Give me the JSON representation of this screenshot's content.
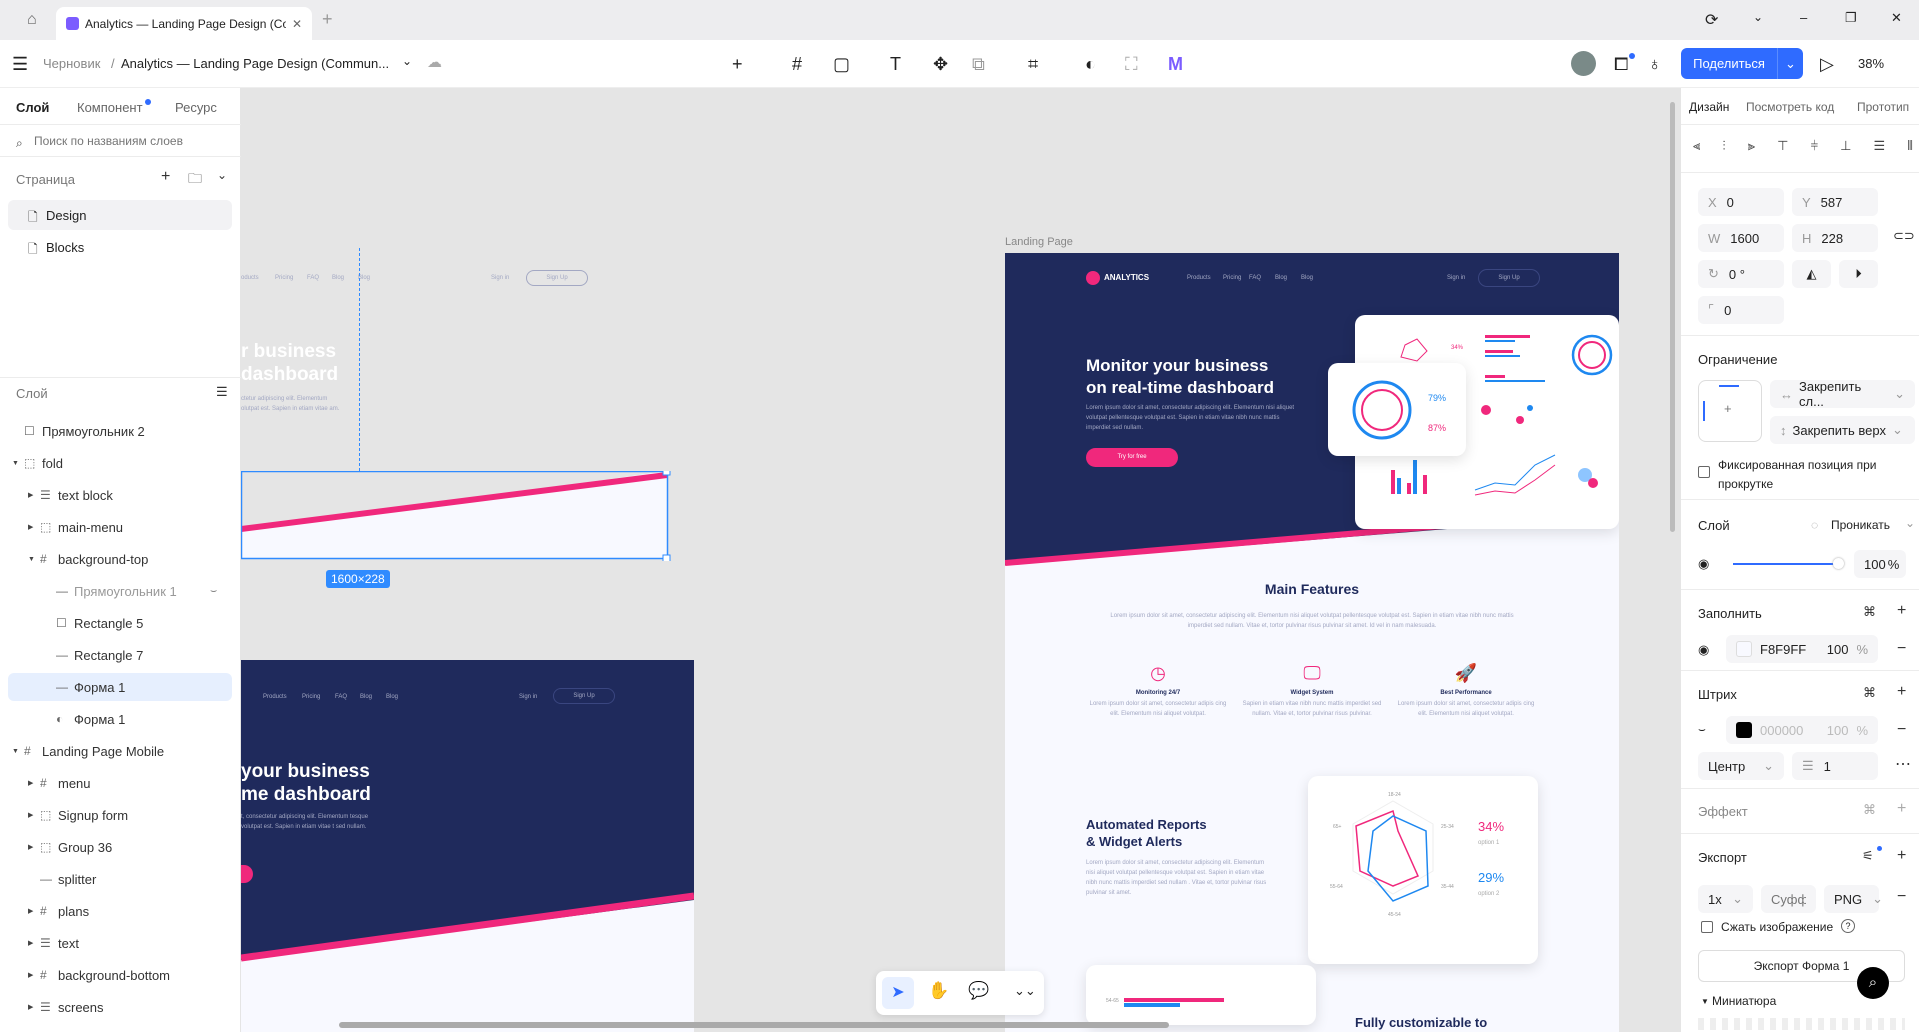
{
  "browser": {
    "tab_title": "Analytics — Landing Page Design (Cor",
    "new_tab": "+",
    "home_icon": "home-icon",
    "close_icon": "close-icon"
  },
  "toolbar": {
    "breadcrumb_root": "Черновик",
    "breadcrumb_sep": "/",
    "file_name": "Analytics — Landing Page Design (Commun...",
    "share_label": "Поделиться",
    "zoom": "38%"
  },
  "left_panel": {
    "tabs": [
      {
        "label": "Слой",
        "active": true
      },
      {
        "label": "Компонент",
        "badge": true
      },
      {
        "label": "Ресурс"
      }
    ],
    "search_placeholder": "Поиск по названиям слоев",
    "pages_header": "Страница",
    "pages": [
      {
        "label": "Design",
        "active": true
      },
      {
        "label": "Blocks"
      }
    ],
    "layers_header": "Слой",
    "layers": [
      {
        "label": "Прямоугольник 2",
        "indent": 0,
        "icon": "rect"
      },
      {
        "label": "fold",
        "indent": 0,
        "icon": "group",
        "expanded": true
      },
      {
        "label": "text block",
        "indent": 1,
        "icon": "stack",
        "collapsed": true
      },
      {
        "label": "main-menu",
        "indent": 1,
        "icon": "group",
        "collapsed": true
      },
      {
        "label": "background-top",
        "indent": 1,
        "icon": "frame",
        "expanded": true
      },
      {
        "label": "Прямоугольник 1",
        "indent": 2,
        "icon": "line",
        "hidden": true
      },
      {
        "label": "Rectangle 5",
        "indent": 2,
        "icon": "rect"
      },
      {
        "label": "Rectangle 7",
        "indent": 2,
        "icon": "line"
      },
      {
        "label": "Форма 1",
        "indent": 2,
        "icon": "line",
        "selected": true
      },
      {
        "label": "Форма 1",
        "indent": 2,
        "icon": "mask"
      },
      {
        "label": "Landing Page Mobile",
        "indent": 0,
        "icon": "frame",
        "expanded": true
      },
      {
        "label": "menu",
        "indent": 1,
        "icon": "frame",
        "collapsed": true
      },
      {
        "label": "Signup form",
        "indent": 1,
        "icon": "group",
        "collapsed": true
      },
      {
        "label": "Group 36",
        "indent": 1,
        "icon": "group",
        "collapsed": true
      },
      {
        "label": "splitter",
        "indent": 1,
        "icon": "line"
      },
      {
        "label": "plans",
        "indent": 1,
        "icon": "frame",
        "collapsed": true
      },
      {
        "label": "text",
        "indent": 1,
        "icon": "stack",
        "collapsed": true
      },
      {
        "label": "background-bottom",
        "indent": 1,
        "icon": "frame",
        "collapsed": true
      },
      {
        "label": "screens",
        "indent": 1,
        "icon": "stack",
        "collapsed": true
      }
    ]
  },
  "canvas": {
    "frame_label": "Landing Page",
    "selection_size": "1600×228",
    "landing": {
      "logo": "ANALYTICS",
      "nav": [
        "Products",
        "Pricing",
        "FAQ",
        "Blog",
        "Blog"
      ],
      "sign_in": "Sign in",
      "sign_up": "Sign Up",
      "headline1": "Monitor your business",
      "headline2": "on real-time dashboard",
      "hero_text": "Lorem ipsum dolor sit amet, consectetur adipiscing elit. Elementum nisi aliquet volutpat pellentesque volutpat est. Sapien in etiam vitae nibh nunc mattis imperdiet sed nullam.",
      "cta": "Try for free",
      "dash_pct1": "79%",
      "dash_pct2": "87%",
      "dash_small_pct": "34%",
      "features_title": "Main Features",
      "features_text": "Lorem ipsum dolor sit amet, consectetur adipiscing elit. Elementum nisi aliquet volutpat pellentesque volutpat est. Sapien in etiam vitae nibh nunc mattis imperdiet sed nullam. Vitae et, tortor pulvinar risus pulvinar sit amet. Id vel in nam malesuada.",
      "features": [
        {
          "title": "Monitoring 24/7",
          "text": "Lorem ipsum dolor sit amet, consectetur adipis cing elit. Elementum nisi aliquet volutpat.",
          "icon": "clock-icon"
        },
        {
          "title": "Widget System",
          "text": "Sapien in etiam vitae nibh nunc mattis imperdiet sed nullam. Vitae et, tortor pulvinar risus pulvinar.",
          "icon": "monitor-icon"
        },
        {
          "title": "Best Performance",
          "text": "Lorem ipsum dolor sit amet, consectetur adipis cing elit. Elementum nisi aliquet volutpat.",
          "icon": "rocket-icon"
        }
      ],
      "reports_title1": "Automated Reports",
      "reports_title2": "& Widget Alerts",
      "reports_text": "Lorem ipsum dolor sit amet, consectetur adipiscing elit. Elementum nisi aliquet volutpat pellentesque volutpat est. Sapien in etiam vitae nibh nunc mattis imperdiet sed nullam . Vitae et, tortor pulvinar risus pulvinar sit amet.",
      "radar_labels": [
        "18-24",
        "25-34",
        "35-44",
        "45-54",
        "55-64",
        "65+"
      ],
      "option1_pct": "34%",
      "option1_label": "option 1",
      "option2_pct": "29%",
      "option2_label": "option 2",
      "bar_label": "54-65",
      "custom_title": "Fully customizable to"
    },
    "ghost": {
      "nav": [
        "oducts",
        "Pricing",
        "FAQ",
        "Blog",
        "Blog"
      ],
      "sign_in": "Sign in",
      "sign_up": "Sign Up",
      "h1": "r business",
      "h2": "dashboard",
      "text": "ctetur adipiscing elit. Elementum olutpat est. Sapien in etiam vitae am."
    },
    "mobile": {
      "nav": [
        "Products",
        "Pricing",
        "FAQ",
        "Blog",
        "Blog"
      ],
      "sign_in": "Sign in",
      "sign_up": "Sign Up",
      "h1": "your business",
      "h2": "me dashboard",
      "text": "t, consectetur adipiscing elit. Elementum tesque volutpat est. Sapien in etiam vitae t sed nullam."
    }
  },
  "right_panel": {
    "tabs": [
      {
        "label": "Дизайн",
        "active": true
      },
      {
        "label": "Посмотреть код"
      },
      {
        "label": "Прототип"
      }
    ],
    "x": "0",
    "y": "587",
    "w": "1600",
    "h": "228",
    "rotation": "0 °",
    "radius": "0",
    "constraints_header": "Ограничение",
    "constraint_h": "Закрепить сл...",
    "constraint_v": "Закрепить верх",
    "fixed_label": "Фиксированная позиция при прокрутке",
    "layer_header": "Слой",
    "blend": "Проникать",
    "opacity": "100",
    "opacity_unit": "%",
    "fill_header": "Заполнить",
    "fill_hex": "F8F9FF",
    "fill_opacity": "100",
    "pct": "%",
    "stroke_header": "Штрих",
    "stroke_hex": "000000",
    "stroke_opacity": "100",
    "stroke_align": "Центр",
    "stroke_width": "1",
    "effect_header": "Эффект",
    "export_header": "Экспорт",
    "export_scale": "1x",
    "export_suffix_placeholder": "Суфф...",
    "export_format": "PNG",
    "compress_label": "Сжать изображение",
    "export_button": "Экспорт Форма 1",
    "thumbnail": "Миниатюра"
  },
  "colors": {
    "accent": "#2f6bff",
    "navy": "#1f2a5c",
    "pink": "#f0287c",
    "blue": "#1e88f0",
    "fill": "#F8F9FF"
  }
}
